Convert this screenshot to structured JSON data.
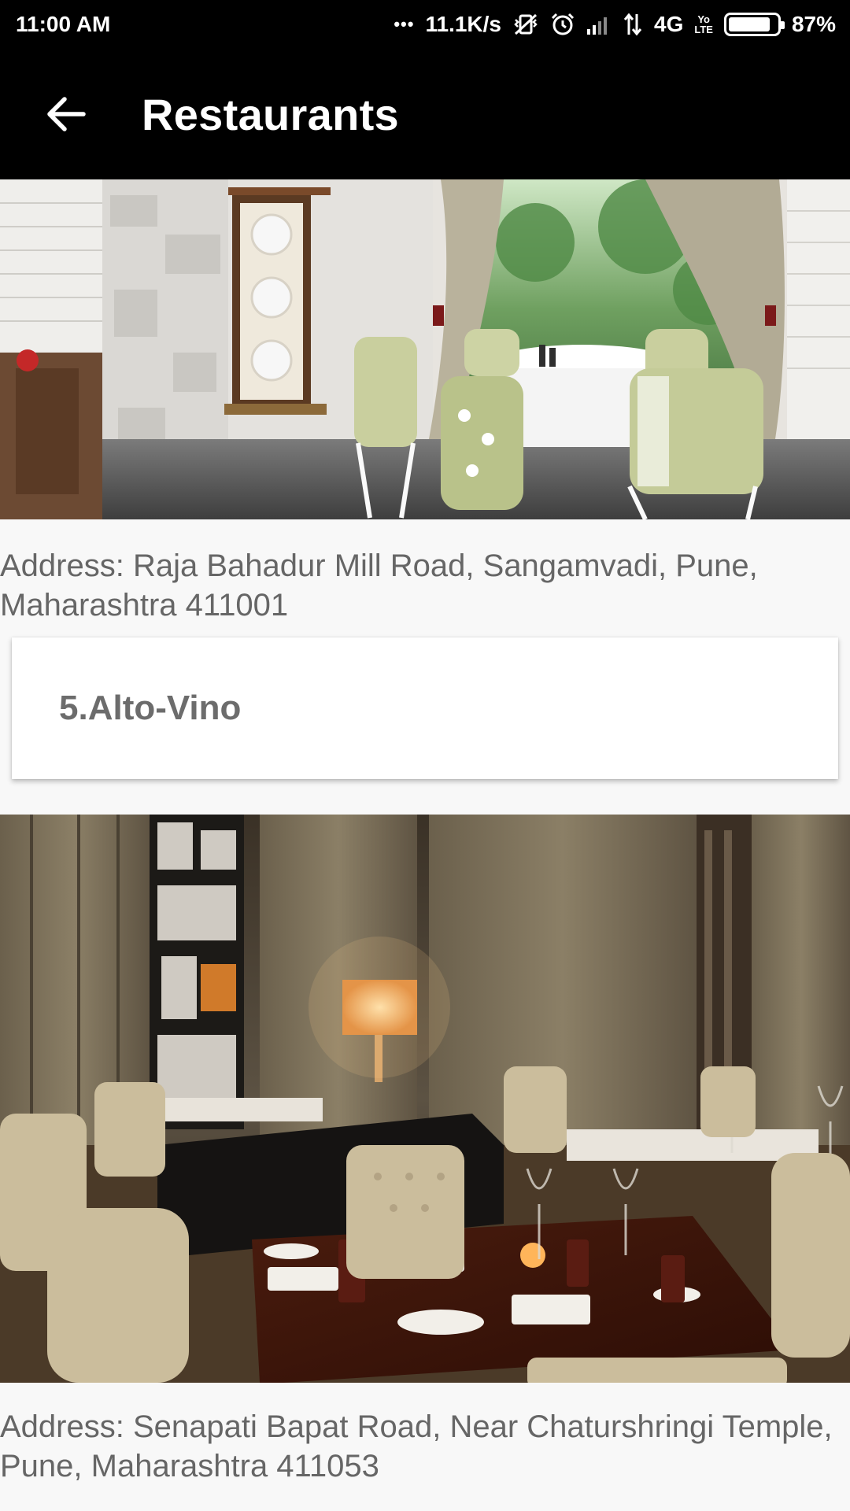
{
  "status_bar": {
    "time": "11:00 AM",
    "dots": "•••",
    "net_speed": "11.1K/s",
    "network": "4G",
    "volte_top": "Yo",
    "volte_bottom": "LTE",
    "battery_percent": "87%",
    "battery_level": 0.87,
    "icons": [
      "vibrate-icon",
      "alarm-icon",
      "signal-icon",
      "data-arrows-icon",
      "volte-icon",
      "battery-icon"
    ]
  },
  "app_bar": {
    "title": "Restaurants",
    "back_icon": "arrow-left-icon"
  },
  "list": [
    {
      "image": "restaurant-interior-photo",
      "address": "Address: Raja Bahadur Mill Road, Sangamvadi, Pune, Maharashtra 411001"
    },
    {
      "title": "5.Alto-Vino",
      "image": "restaurant-dining-photo",
      "address": "Address: Senapati Bapat Road, Near Chaturshringi Temple, Pune, Maharashtra 411053"
    }
  ]
}
